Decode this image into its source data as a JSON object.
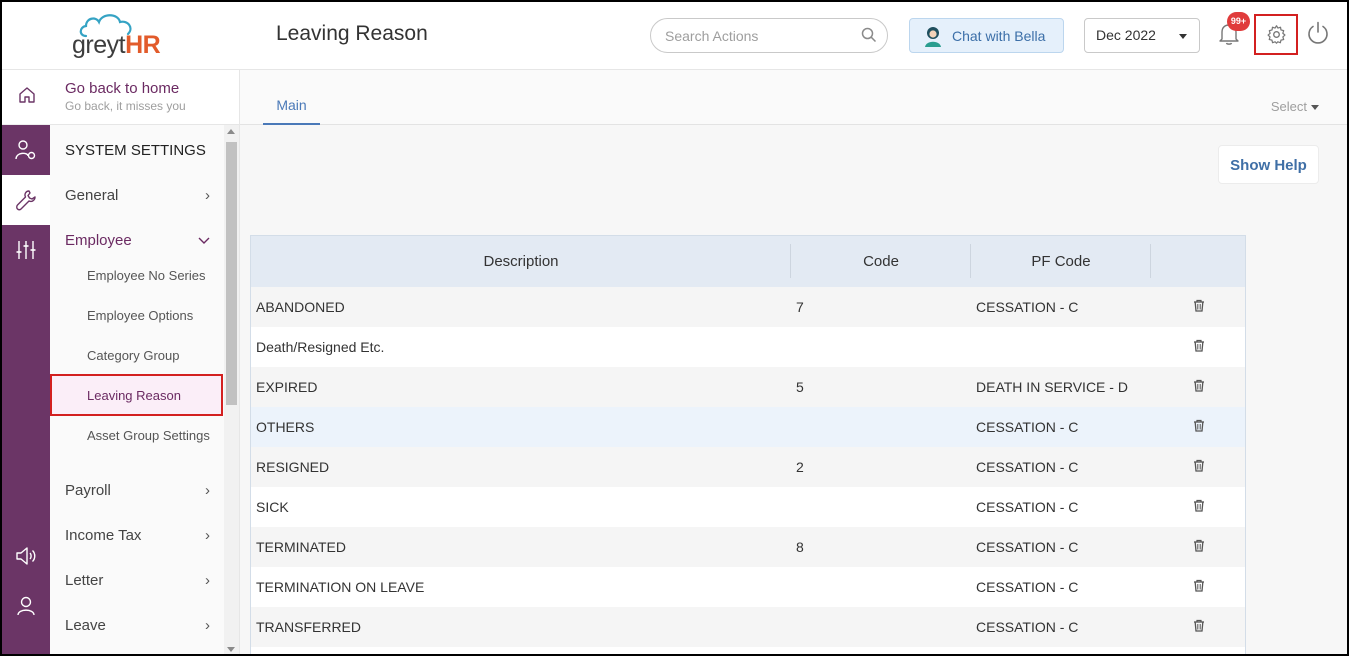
{
  "app": {
    "logo_prefix": "greyt",
    "logo_suffix": "HR",
    "page_title": "Leaving Reason"
  },
  "header": {
    "search_placeholder": "Search Actions",
    "chat_label": "Chat with Bella",
    "month_value": "Dec 2022",
    "notification_badge": "99+",
    "highlight_color": "#d32020"
  },
  "sidebar": {
    "back_title": "Go back to home",
    "back_subtitle": "Go back, it misses you",
    "section_title": "SYSTEM SETTINGS",
    "items": [
      {
        "label": "General"
      },
      {
        "label": "Employee"
      },
      {
        "label": "Payroll"
      },
      {
        "label": "Income Tax"
      },
      {
        "label": "Letter"
      },
      {
        "label": "Leave"
      }
    ],
    "employee_sub": [
      {
        "label": "Employee No Series"
      },
      {
        "label": "Employee Options"
      },
      {
        "label": "Category Group"
      },
      {
        "label": "Leaving Reason"
      },
      {
        "label": "Asset Group Settings"
      }
    ],
    "accent_color": "#6b3566"
  },
  "main": {
    "tab_label": "Main",
    "select_label": "Select",
    "help_label": "Show Help",
    "columns": [
      "Description",
      "Code",
      "PF Code",
      ""
    ],
    "rows": [
      {
        "description": "ABANDONED",
        "code": "7",
        "pf_code": "CESSATION - C"
      },
      {
        "description": "Death/Resigned Etc.",
        "code": "",
        "pf_code": ""
      },
      {
        "description": "EXPIRED",
        "code": "5",
        "pf_code": "DEATH IN SERVICE - D"
      },
      {
        "description": "OTHERS",
        "code": "",
        "pf_code": "CESSATION - C"
      },
      {
        "description": "RESIGNED",
        "code": "2",
        "pf_code": "CESSATION - C"
      },
      {
        "description": "SICK",
        "code": "",
        "pf_code": "CESSATION - C"
      },
      {
        "description": "TERMINATED",
        "code": "8",
        "pf_code": "CESSATION - C"
      },
      {
        "description": "TERMINATION ON LEAVE",
        "code": "",
        "pf_code": "CESSATION - C"
      },
      {
        "description": "TRANSFERRED",
        "code": "",
        "pf_code": "CESSATION - C"
      }
    ]
  }
}
